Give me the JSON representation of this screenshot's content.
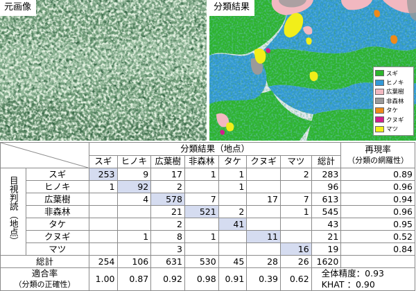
{
  "left_panel": {
    "title": "元画像"
  },
  "right_panel": {
    "title": "分類結果"
  },
  "legend": [
    {
      "label": "スギ",
      "color": "#2db52d"
    },
    {
      "label": "ヒノキ",
      "color": "#3399d6"
    },
    {
      "label": "広葉樹",
      "color": "#f2b8c0"
    },
    {
      "label": "非森林",
      "color": "#9a9a9a"
    },
    {
      "label": "タケ",
      "color": "#ee8a1a"
    },
    {
      "label": "クヌギ",
      "color": "#d21d8c"
    },
    {
      "label": "マツ",
      "color": "#f2ee1a"
    }
  ],
  "table": {
    "header_group": "分類結果（地点）",
    "col_headers": [
      "スギ",
      "ヒノキ",
      "広葉樹",
      "非森林",
      "タケ",
      "クヌギ",
      "マツ",
      "総計"
    ],
    "recall_header_1": "再現率",
    "recall_header_2": "（分類の網羅性）",
    "row_group": "目視判読（地点）",
    "rows": [
      {
        "label": "スギ",
        "cells": [
          "253",
          "9",
          "17",
          "1",
          "1",
          "",
          "2",
          "283"
        ],
        "recall": "0.89"
      },
      {
        "label": "ヒノキ",
        "cells": [
          "1",
          "92",
          "2",
          "",
          "1",
          "",
          "",
          "96"
        ],
        "recall": "0.96"
      },
      {
        "label": "広葉樹",
        "cells": [
          "",
          "4",
          "578",
          "7",
          "",
          "17",
          "7",
          "613"
        ],
        "recall": "0.94"
      },
      {
        "label": "非森林",
        "cells": [
          "",
          "",
          "21",
          "521",
          "2",
          "",
          "1",
          "545"
        ],
        "recall": "0.96"
      },
      {
        "label": "タケ",
        "cells": [
          "",
          "",
          "2",
          "",
          "41",
          "",
          "",
          "43"
        ],
        "recall": "0.95"
      },
      {
        "label": "クヌギ",
        "cells": [
          "",
          "1",
          "8",
          "1",
          "",
          "11",
          "",
          "21"
        ],
        "recall": "0.52"
      },
      {
        "label": "マツ",
        "cells": [
          "",
          "",
          "3",
          "",
          "",
          "",
          "16",
          "19"
        ],
        "recall": "0.84"
      }
    ],
    "total_row": {
      "label": "総計",
      "cells": [
        "254",
        "106",
        "631",
        "530",
        "45",
        "28",
        "26",
        "1620"
      ]
    },
    "precision_label_1": "適合率",
    "precision_label_2": "（分類の正確性）",
    "precision_values": [
      "1.00",
      "0.87",
      "0.92",
      "0.98",
      "0.91",
      "0.39",
      "0.62"
    ],
    "overall_accuracy": "全体精度：0.93",
    "khat": "KHAT ：0.90"
  }
}
